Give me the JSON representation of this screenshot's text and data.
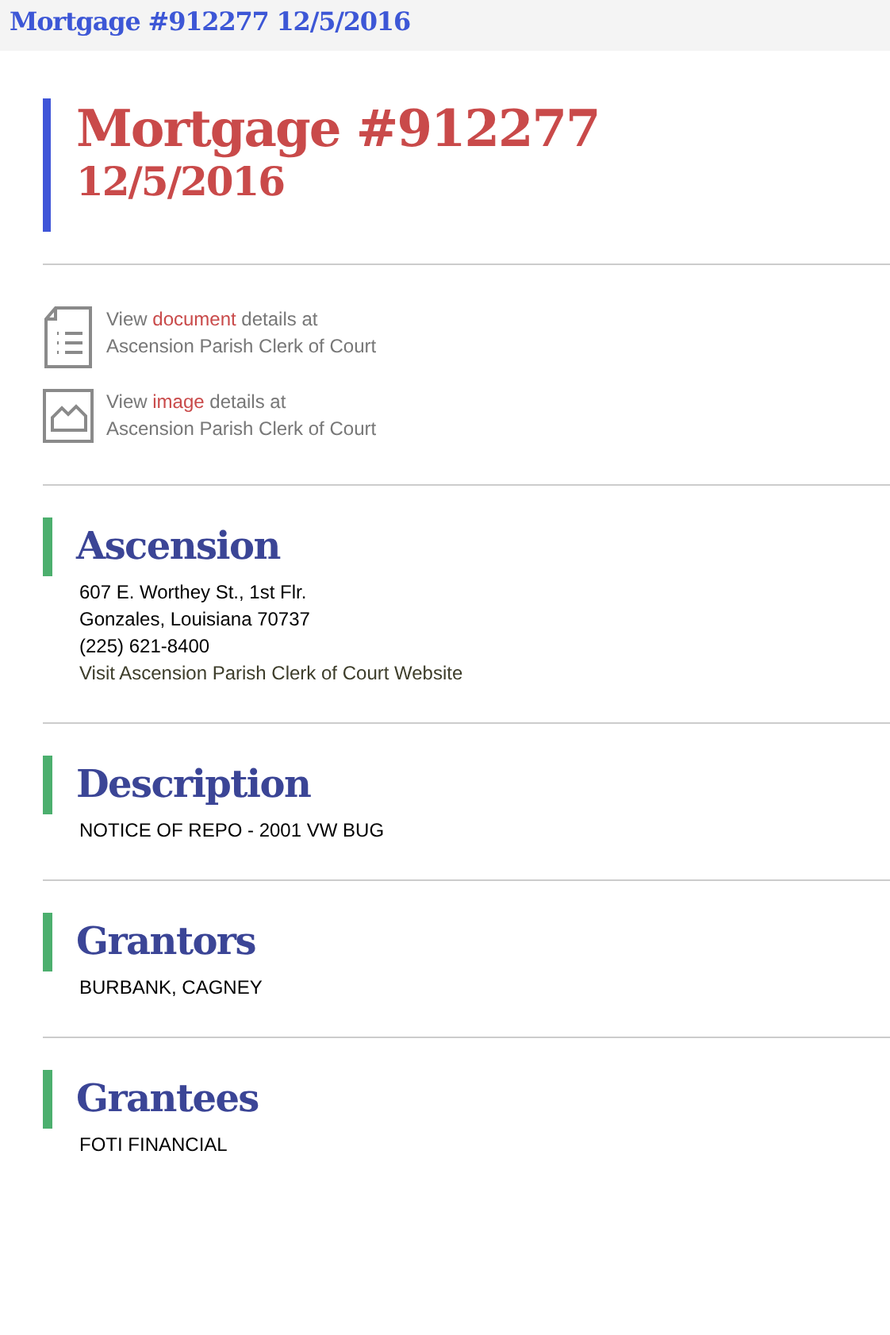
{
  "top_bar": {
    "title": "Mortgage #912277 12/5/2016"
  },
  "header": {
    "title": "Mortgage #912277",
    "date": "12/5/2016"
  },
  "view_links": [
    {
      "kind": "document",
      "prefix": "View ",
      "link": "document",
      "suffix": " details at",
      "line2": "Ascension Parish Clerk of Court"
    },
    {
      "kind": "image",
      "prefix": "View ",
      "link": "image",
      "suffix": " details at",
      "line2": "Ascension Parish Clerk of Court"
    }
  ],
  "sections": [
    {
      "heading": "Ascension",
      "lines": [
        {
          "kind": "text",
          "text": "607 E. Worthey St., 1st Flr."
        },
        {
          "kind": "text",
          "text": "Gonzales, Louisiana 70737"
        },
        {
          "kind": "text",
          "text": "(225) 621-8400"
        },
        {
          "kind": "link",
          "text": "Visit Ascension Parish Clerk of Court Website"
        }
      ]
    },
    {
      "heading": "Description",
      "lines": [
        {
          "kind": "text",
          "text": "NOTICE OF REPO - 2001 VW BUG"
        }
      ]
    },
    {
      "heading": "Grantors",
      "lines": [
        {
          "kind": "text",
          "text": "BURBANK, CAGNEY"
        }
      ]
    },
    {
      "heading": "Grantees",
      "lines": [
        {
          "kind": "text",
          "text": "FOTI FINANCIAL"
        }
      ]
    }
  ]
}
